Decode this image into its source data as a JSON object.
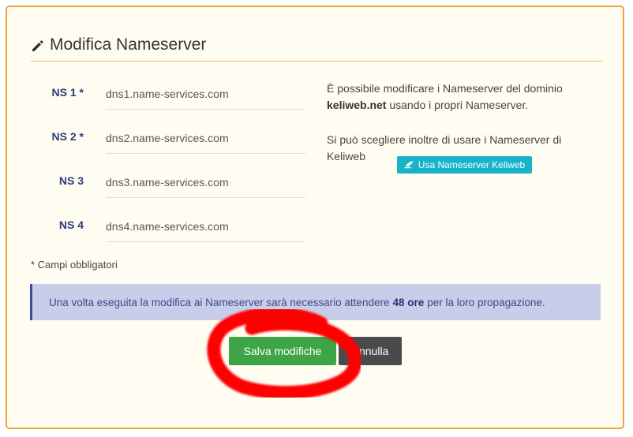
{
  "header": {
    "title": "Modifica Nameserver"
  },
  "nameservers": [
    {
      "label": "NS 1 *",
      "value": "dns1.name-services.com"
    },
    {
      "label": "NS 2 *",
      "value": "dns2.name-services.com"
    },
    {
      "label": "NS 3",
      "value": "dns3.name-services.com"
    },
    {
      "label": "NS 4",
      "value": "dns4.name-services.com"
    }
  ],
  "info": {
    "line1_prefix": "È possibile modificare i Nameserver del dominio",
    "domain": "keliweb.net",
    "line1_suffix": "usando i propri Nameserver.",
    "line2": "Si può scegliere inoltre di usare i Nameserver di Keliweb",
    "keliweb_button_label": "Usa Nameserver Keliweb"
  },
  "required_note": "* Campi obbligatori",
  "alert": {
    "prefix": "Una volta eseguita la modifica ai Nameserver sarà necessario attendere",
    "highlight": "48 ore",
    "suffix": "per la loro propagazione."
  },
  "actions": {
    "save_label": "Salva modifiche",
    "cancel_label": "Annulla"
  },
  "colors": {
    "panel_border": "#f3a33a",
    "panel_bg": "#fffdf2",
    "label_blue": "#2d3b7a",
    "keliweb_button": "#17b4c8",
    "alert_bg": "#c8cde9",
    "save_green": "#3ea546",
    "cancel_dark": "#4a4a4a",
    "annotation_red": "#ff0000"
  }
}
